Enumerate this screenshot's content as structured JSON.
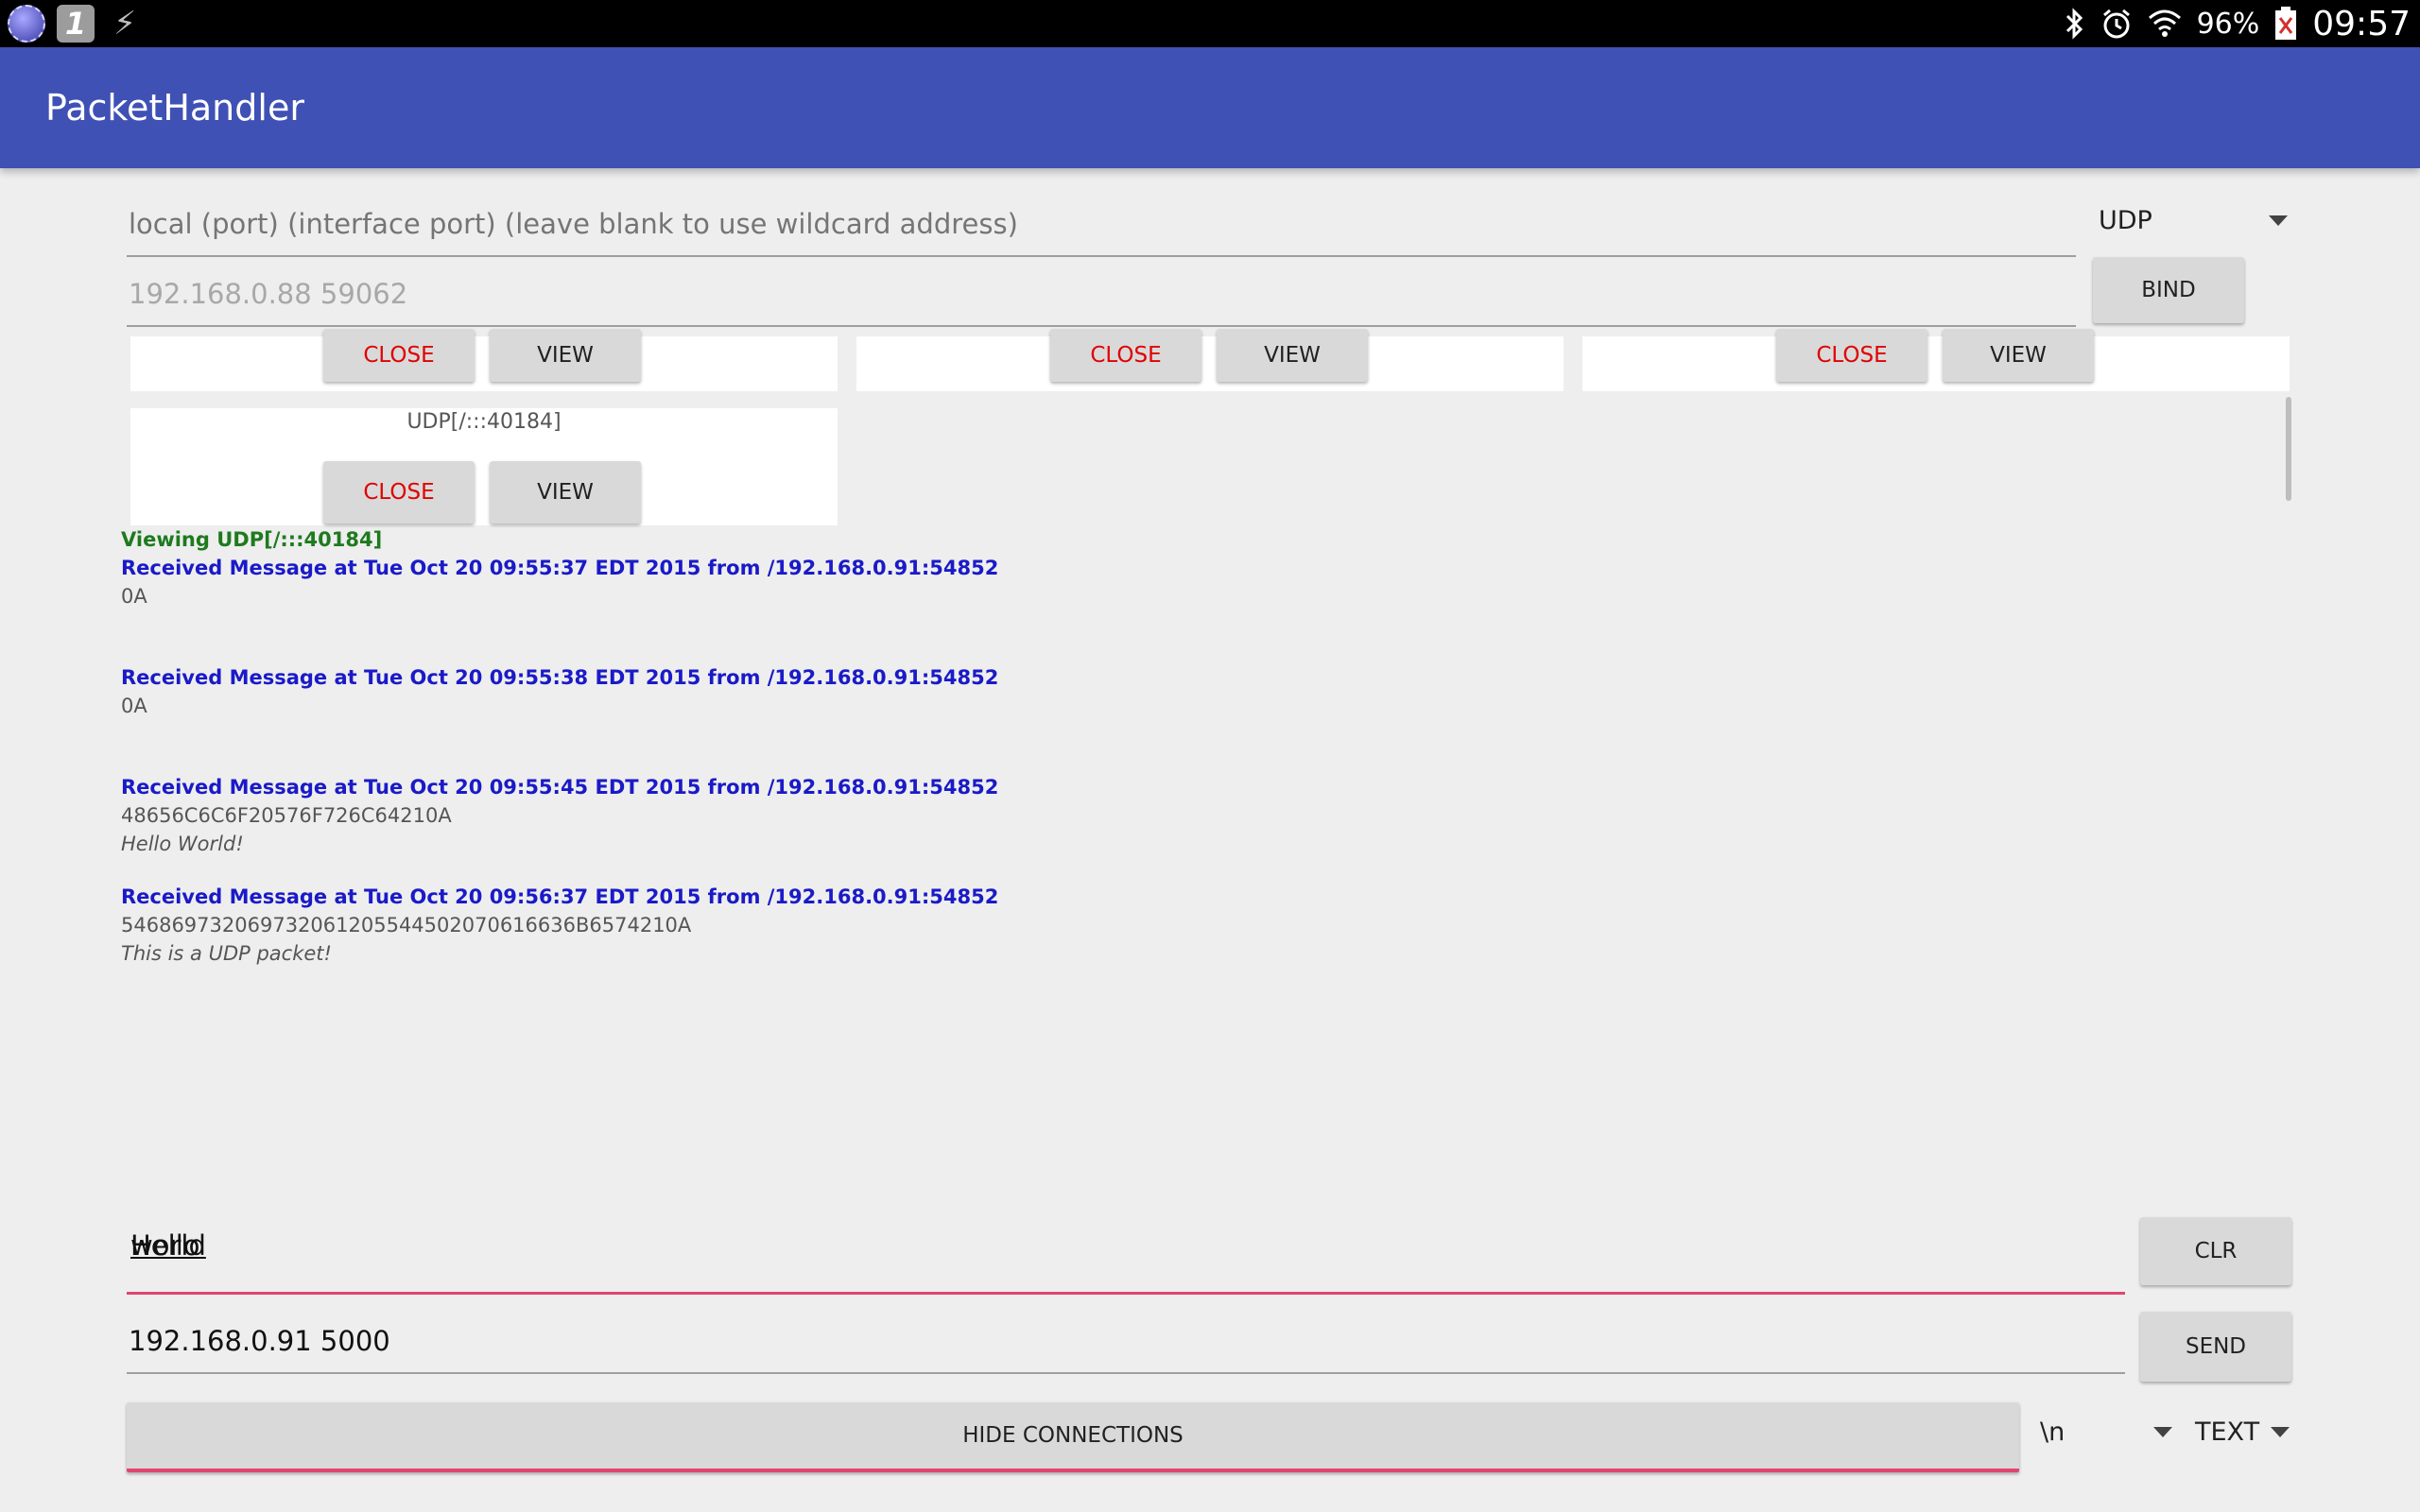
{
  "status_bar": {
    "battery": "96%",
    "time": "09:57",
    "notif_icon_b": "1"
  },
  "app_bar": {
    "title": "PacketHandler"
  },
  "bind": {
    "local_hint": "local (port) (interface port) (leave blank to use wildcard address)",
    "protocol": "UDP",
    "address_placeholder": "192.168.0.88 59062",
    "bind_label": "BIND"
  },
  "connections": [
    {
      "title": "",
      "close_label": "CLOSE",
      "view_label": "VIEW"
    },
    {
      "title": "",
      "close_label": "CLOSE",
      "view_label": "VIEW"
    },
    {
      "title": "",
      "close_label": "CLOSE",
      "view_label": "VIEW"
    },
    {
      "title": "UDP[/:::40184]",
      "close_label": "CLOSE",
      "view_label": "VIEW"
    }
  ],
  "log": {
    "viewing": "Viewing UDP[/:::40184]",
    "entries": [
      {
        "header": "Received Message at Tue Oct 20 09:55:37 EDT 2015 from /192.168.0.91:54852",
        "hex": "0A",
        "text": ""
      },
      {
        "header": "Received Message at Tue Oct 20 09:55:38 EDT 2015 from /192.168.0.91:54852",
        "hex": "0A",
        "text": ""
      },
      {
        "header": "Received Message at Tue Oct 20 09:55:45 EDT 2015 from /192.168.0.91:54852",
        "hex": "48656C6C6F20576F726C64210A",
        "text": "Hello World!"
      },
      {
        "header": "Received Message at Tue Oct 20 09:56:37 EDT 2015 from /192.168.0.91:54852",
        "hex": "546869732069732061205544502070616636B6574210A",
        "text": "This is a UDP packet!"
      }
    ]
  },
  "send": {
    "message_word1": "Hello",
    "message_word2": "world",
    "clr_label": "CLR",
    "target": "192.168.0.91 5000",
    "send_label": "SEND",
    "hide_label": "HIDE CONNECTIONS",
    "line_ending": "\\n",
    "mode": "TEXT"
  },
  "colors": {
    "app_bar": "#3f51b5",
    "close_text": "#e00000",
    "log_header": "#1a1ac8",
    "log_viewing": "#1e7a1e",
    "focus_underline": "#e2456f"
  }
}
